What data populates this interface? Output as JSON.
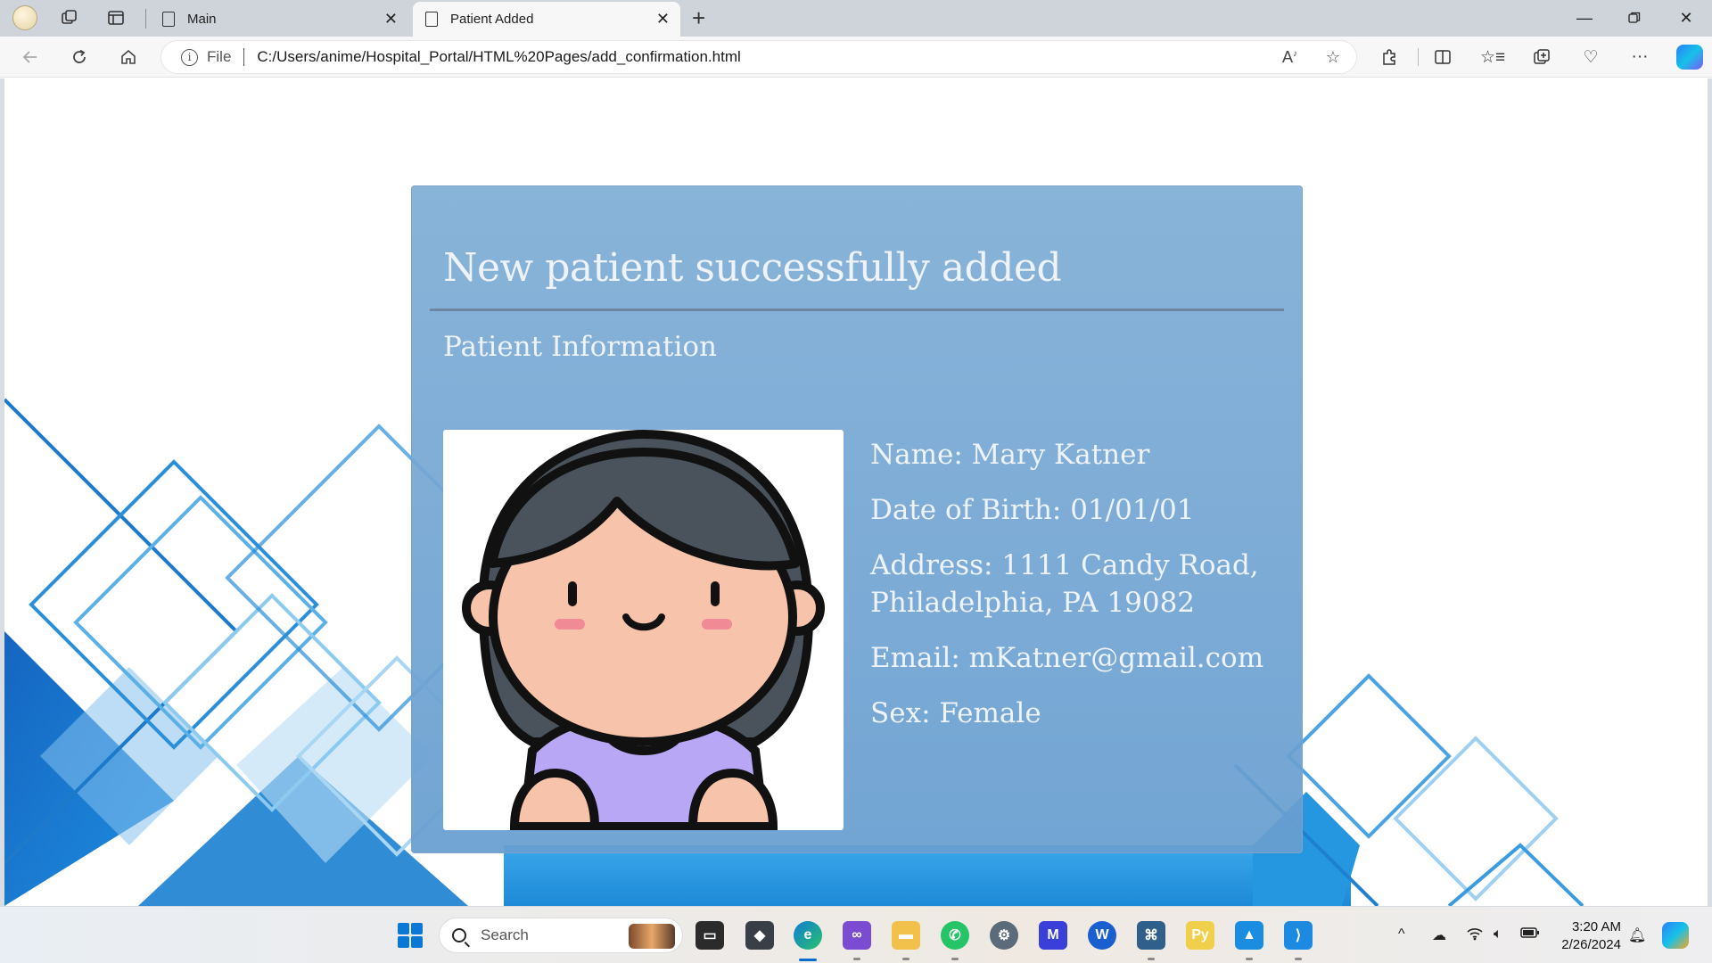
{
  "browser": {
    "tabs": [
      {
        "label": "Main",
        "active": false
      },
      {
        "label": "Patient Added",
        "active": true
      }
    ],
    "address": {
      "scheme_label": "File",
      "url": "C:/Users/anime/Hospital_Portal/HTML%20Pages/add_confirmation.html"
    }
  },
  "page": {
    "heading": "New patient successfully added",
    "subheading": "Patient Information",
    "patient": {
      "name": "Name: Mary Katner",
      "dob": "Date of Birth: 01/01/01",
      "address": "Address: 1111 Candy Road, Philadelphia, PA 19082",
      "email": "Email: mKatner@gmail.com",
      "sex": "Sex: Female"
    },
    "avatar_icon": "girl-avatar-icon"
  },
  "taskbar": {
    "search_placeholder": "Search",
    "clock_time": "3:20 AM",
    "clock_date": "2/26/2024"
  },
  "colors": {
    "card_bg": "#80aed6",
    "card_text": "#eef3f9",
    "accent_blue": "#0a78d4"
  }
}
